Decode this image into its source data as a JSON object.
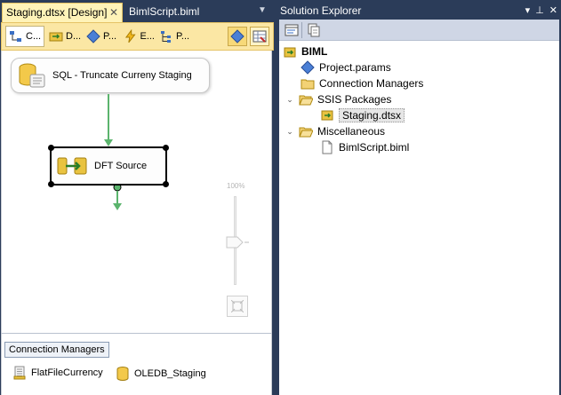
{
  "designer": {
    "tabs": [
      {
        "label": "Staging.dtsx [Design]",
        "active": true
      },
      {
        "label": "BimlScript.biml",
        "active": false
      }
    ],
    "subtabs": [
      "C...",
      "D...",
      "P...",
      "E...",
      "P..."
    ],
    "tasks": {
      "sql": "SQL - Truncate Curreny Staging",
      "dft": "DFT Source"
    },
    "zoom_label": "100%",
    "connection_managers": {
      "title": "Connection Managers",
      "items": [
        "FlatFileCurrency",
        "OLEDB_Staging"
      ]
    }
  },
  "solution_explorer": {
    "title": "Solution Explorer",
    "tree": {
      "root": "BIML",
      "project_params": "Project.params",
      "connection_managers": "Connection Managers",
      "ssis_packages": "SSIS Packages",
      "staging": "Staging.dtsx",
      "miscellaneous": "Miscellaneous",
      "bimlscript": "BimlScript.biml"
    }
  },
  "colors": {
    "chrome_bg": "#2b3c59",
    "active_tab": "#fff3b8",
    "toolbar": "#fbe7a4",
    "flow_arrow": "#5bb46d"
  },
  "icons": [
    "close-icon",
    "dropdown-icon",
    "pin-icon",
    "database-icon",
    "dataflow-icon",
    "folder-icon",
    "file-icon",
    "params-icon"
  ]
}
